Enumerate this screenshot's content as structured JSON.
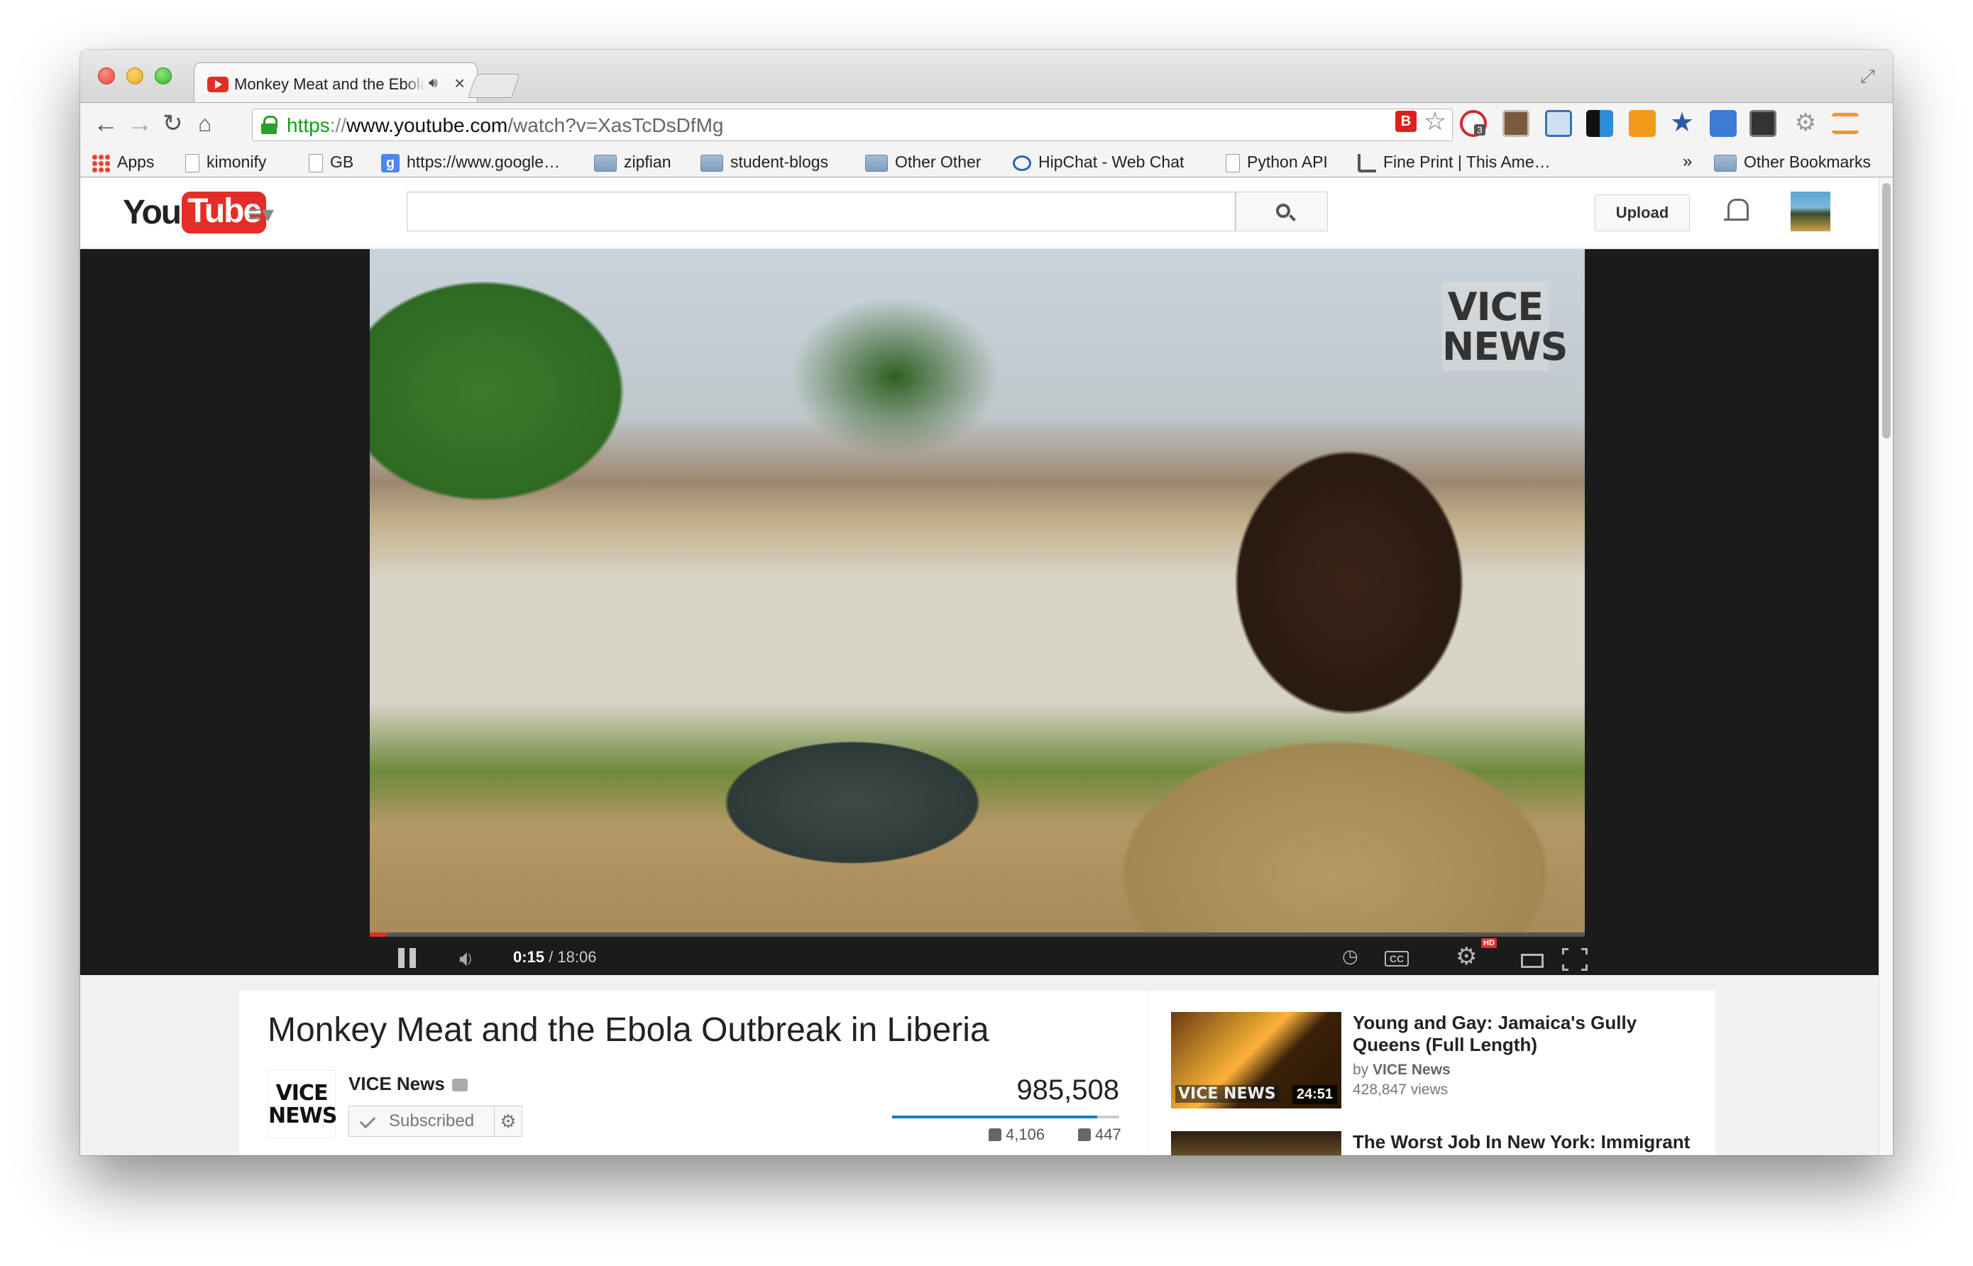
{
  "browser": {
    "tab": {
      "title": "Monkey Meat and the Ebola Outbreak in Liberia",
      "audio_icon": "speaker-icon",
      "close_symbol": "×"
    },
    "url": {
      "scheme": "https",
      "separator": "://",
      "host": "www.youtube.com",
      "path": "/watch?v=XasTcDsDfMg"
    },
    "extension_badge": "3",
    "bookmarks": [
      {
        "label": "Apps",
        "icon": "apps-grid-icon"
      },
      {
        "label": "kimonify",
        "icon": "page-icon"
      },
      {
        "label": "GB",
        "icon": "page-icon"
      },
      {
        "label": "https://www.google…",
        "icon": "google-icon"
      },
      {
        "label": "zipfian",
        "icon": "folder-icon"
      },
      {
        "label": "student-blogs",
        "icon": "folder-icon"
      },
      {
        "label": "Other Other",
        "icon": "folder-icon"
      },
      {
        "label": "HipChat - Web Chat",
        "icon": "chat-icon"
      },
      {
        "label": "Python API",
        "icon": "page-icon"
      },
      {
        "label": "Fine Print | This Ame…",
        "icon": "rss-icon"
      }
    ],
    "bookmarks_overflow": "»",
    "other_bookmarks": "Other Bookmarks"
  },
  "youtube": {
    "logo_you": "You",
    "logo_tube": "Tube",
    "search_placeholder": "",
    "upload_label": "Upload",
    "player": {
      "overlay_line1": "VICE",
      "overlay_line2": "NEWS",
      "current_time": "0:15",
      "duration": " / 18:06",
      "progress_fraction": 0.0138,
      "hd_badge": "HD",
      "cc_label": "CC"
    },
    "video": {
      "title": "Monkey Meat and the Ebola Outbreak in Liberia",
      "channel_logo_line1": "VICE",
      "channel_logo_line2": "NEWS",
      "channel_name": "VICE News",
      "subscribe_label": "Subscribed",
      "views": "985,508",
      "likes": "4,106",
      "dislikes": "447",
      "like_fraction": 0.902
    },
    "related": [
      {
        "title": "Young and Gay: Jamaica's Gully Queens (Full Length)",
        "by_prefix": "by ",
        "channel": "VICE News",
        "views": "428,847 views",
        "duration": "24:51",
        "thumb_logo": "VICE NEWS"
      },
      {
        "title": "The Worst Job In New York: Immigrant",
        "by_prefix": "",
        "channel": "",
        "views": "",
        "duration": "",
        "thumb_logo": ""
      }
    ]
  },
  "colors": {
    "youtube_red": "#e52d27",
    "secure_green": "#109d10",
    "like_blue": "#167ac6"
  }
}
